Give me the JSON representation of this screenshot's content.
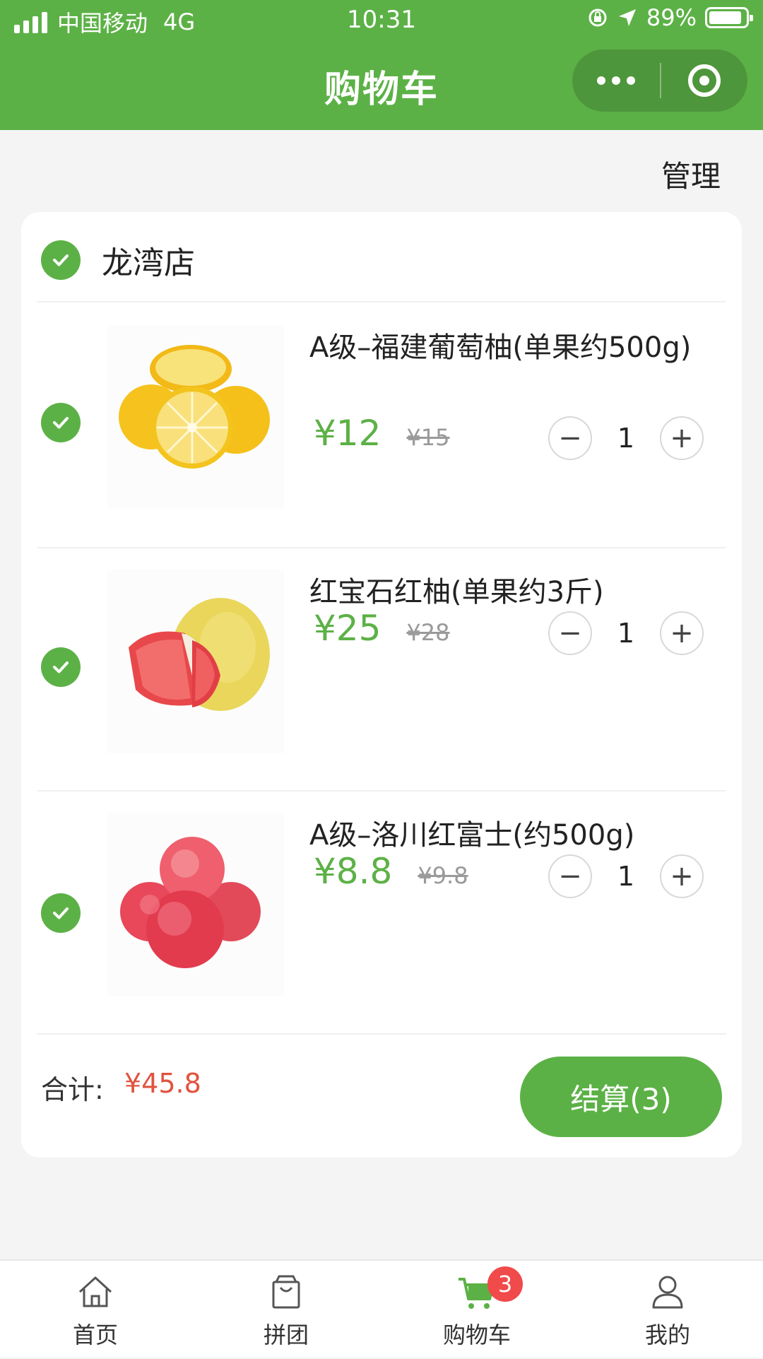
{
  "status_bar": {
    "carrier": "中国移动",
    "network": "4G",
    "time": "10:31",
    "battery": "89%",
    "battery_level": 0.89
  },
  "nav": {
    "title": "购物车"
  },
  "actions": {
    "manage": "管理"
  },
  "store": {
    "name": "龙湾店",
    "checked": true
  },
  "items": [
    {
      "name": "A级–福建葡萄柚(单果约500g)",
      "price": "¥12",
      "old_price": "¥15",
      "qty": "1",
      "checked": true
    },
    {
      "name": "红宝石红柚(单果约3斤)",
      "price": "¥25",
      "old_price": "¥28",
      "qty": "1",
      "checked": true
    },
    {
      "name": "A级–洛川红富士(约500g)",
      "price": "¥8.8",
      "old_price": "¥9.8",
      "qty": "1",
      "checked": true
    }
  ],
  "summary": {
    "total_label": "合计:",
    "total_value": "¥45.8",
    "checkout_label": "结算(3)"
  },
  "tabbar": {
    "tabs": [
      {
        "label": "首页",
        "icon": "home-icon"
      },
      {
        "label": "拼团",
        "icon": "bag-icon"
      },
      {
        "label": "购物车",
        "icon": "cart-icon",
        "badge": "3",
        "active": true
      },
      {
        "label": "我的",
        "icon": "user-icon"
      }
    ]
  },
  "colors": {
    "primary": "#5cb146",
    "price_total": "#e0533f",
    "badge": "#f04a4a"
  }
}
